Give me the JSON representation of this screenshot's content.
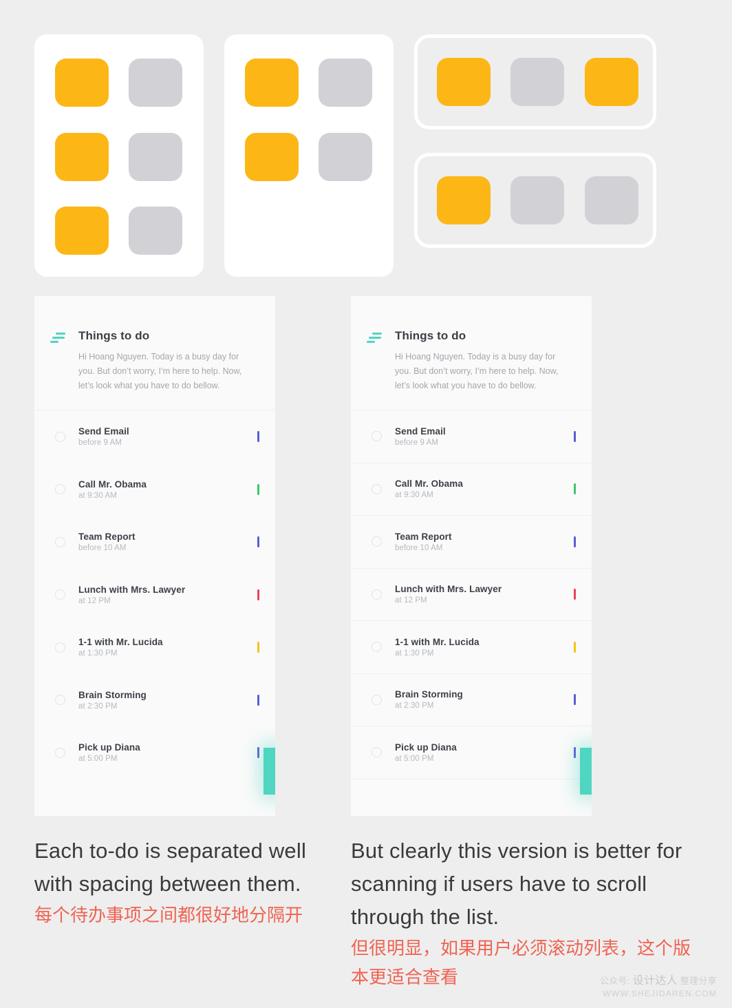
{
  "colors": {
    "background": "#eeeeee",
    "card": "#ffffff",
    "panel": "#fafafa",
    "orange": "#fcb716",
    "gray": "#d2d2d6",
    "accent_teal": "#4fd5c0",
    "caption_en": "#3a3a3a",
    "caption_zh": "#ef6352",
    "divider": "#efefef"
  },
  "spec": {
    "card_grid_3rows": {
      "name": "spacing-grid-three-rows",
      "swatches": [
        "orange",
        "gray",
        "orange",
        "gray",
        "orange",
        "gray"
      ]
    },
    "card_grid_2rows": {
      "name": "spacing-grid-two-rows",
      "swatches": [
        "orange",
        "gray",
        "orange",
        "gray"
      ]
    },
    "row_1": {
      "name": "outlined-row-one",
      "swatches": [
        "orange",
        "gray",
        "orange"
      ]
    },
    "row_2": {
      "name": "outlined-row-two",
      "swatches": [
        "orange",
        "gray",
        "gray"
      ]
    }
  },
  "panel": {
    "icon": "sort-lines-icon",
    "title": "Things to do",
    "subtitle": "Hi Hoang Nguyen. Today is a busy day for you. But don’t worry, I’m here to help. Now, let’s look what you have to do bellow.",
    "fab_label": "+",
    "todos": [
      {
        "title": "Send Email",
        "time": "before 9 AM",
        "flag": "#5b5bd6"
      },
      {
        "title": "Call Mr. Obama",
        "time": "at 9:30 AM",
        "flag": "#3ec46d"
      },
      {
        "title": "Team Report",
        "time": "before 10 AM",
        "flag": "#5b5bd6"
      },
      {
        "title": "Lunch with Mrs. Lawyer",
        "time": "at 12 PM",
        "flag": "#ef4056"
      },
      {
        "title": "1-1 with Mr. Lucida",
        "time": "at 1:30 PM",
        "flag": "#f5c518"
      },
      {
        "title": "Brain Storming",
        "time": "at 2:30 PM",
        "flag": "#5b5bd6"
      },
      {
        "title": "Pick up Diana",
        "time": "at 5:00 PM",
        "flag": "#5b5bd6"
      }
    ]
  },
  "captions": {
    "left": {
      "en": "Each to-do is separated well with spacing between them.",
      "zh": "每个待办事项之间都很好地分隔开"
    },
    "right": {
      "en": "But clearly this version is better for scanning if users have to scroll through the list.",
      "zh": "但很明显，如果用户必须滚动列表，这个版本更适合查看"
    }
  },
  "watermark": {
    "line1_prefix": "公众号: ",
    "line1_brand": "设计达人",
    "line1_suffix": " 整理分享",
    "line2": "WWW.SHEJIDAREN.COM"
  }
}
